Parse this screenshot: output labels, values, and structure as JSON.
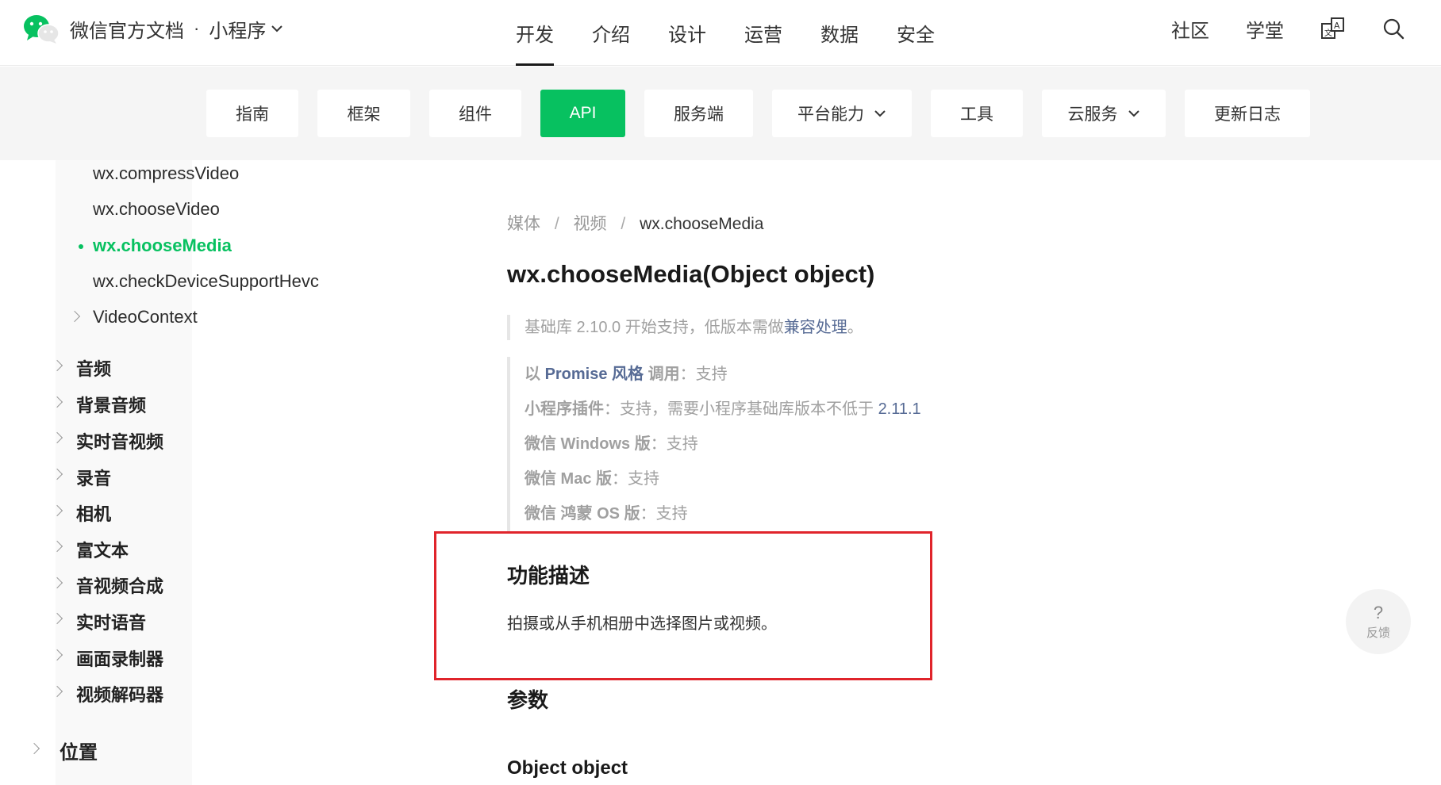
{
  "brand": {
    "title": "微信官方文档",
    "dot": "·",
    "sub": "小程序"
  },
  "main_nav": [
    "开发",
    "介绍",
    "设计",
    "运营",
    "数据",
    "安全"
  ],
  "right_nav": {
    "community": "社区",
    "academy": "学堂"
  },
  "tabs": [
    "指南",
    "框架",
    "组件",
    "API",
    "服务端",
    "平台能力",
    "工具",
    "云服务",
    "更新日志"
  ],
  "sidebar": {
    "video_items": [
      "wx.compressVideo",
      "wx.chooseVideo",
      "wx.chooseMedia",
      "wx.checkDeviceSupportHevc",
      "VideoContext"
    ],
    "media_groups": [
      "音频",
      "背景音频",
      "实时音视频",
      "录音",
      "相机",
      "富文本",
      "音视频合成",
      "实时语音",
      "画面录制器",
      "视频解码器"
    ],
    "top_group": "位置"
  },
  "content": {
    "breadcrumb": [
      "媒体",
      "视频",
      "wx.chooseMedia"
    ],
    "title": "wx.chooseMedia(Object object)",
    "support_prefix": "基础库 2.10.0 开始支持，低版本需做",
    "support_link": "兼容处理",
    "support_suffix": "。",
    "support_rows": {
      "promise_pre": "以 ",
      "promise_link": "Promise 风格",
      "promise_post": " 调用",
      "promise_val": "：支持",
      "plugin_label": "小程序插件",
      "plugin_val": "：支持，需要小程序基础库版本不低于 ",
      "plugin_ver": "2.11.1",
      "windows_label": "微信 Windows 版",
      "windows_val": "：支持",
      "mac_label": "微信 Mac 版",
      "mac_val": "：支持",
      "harmony_label": "微信 鸿蒙 OS 版",
      "harmony_val": "：支持"
    },
    "section_desc_title": "功能描述",
    "section_desc_text": "拍摄或从手机相册中选择图片或视频。",
    "section_params_title": "参数",
    "section_object_title": "Object object"
  },
  "feedback": {
    "icon": "?",
    "label": "反馈"
  },
  "colors": {
    "accent": "#07c160",
    "link": "#576b95",
    "highlight_box": "#e0242b"
  }
}
